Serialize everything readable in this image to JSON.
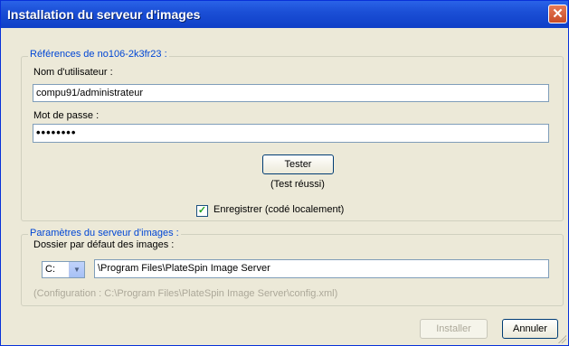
{
  "window": {
    "title": "Installation du serveur d'images"
  },
  "credentials": {
    "group_title": "Références de no106-2k3fr23 :",
    "username_label": "Nom d'utilisateur :",
    "username_value": "compu91/administrateur",
    "password_label": "Mot de passe :",
    "password_value": "••••••••",
    "test_button": "Tester",
    "test_status": "(Test réussi)",
    "save_checked": true,
    "save_label": "Enregistrer (codé localement)"
  },
  "server_params": {
    "group_title": "Paramètres du serveur d'images :",
    "folder_label": "Dossier par défaut des images :",
    "drive_value": "C:",
    "path_value": "\\Program Files\\PlateSpin Image Server",
    "config_text": "(Configuration :  C:\\Program Files\\PlateSpin Image Server\\config.xml)"
  },
  "footer": {
    "install_button": "Installer",
    "cancel_button": "Annuler"
  },
  "icons": {
    "close": "close-icon",
    "check": "checkmark-icon",
    "dropdown": "chevron-down-icon"
  }
}
